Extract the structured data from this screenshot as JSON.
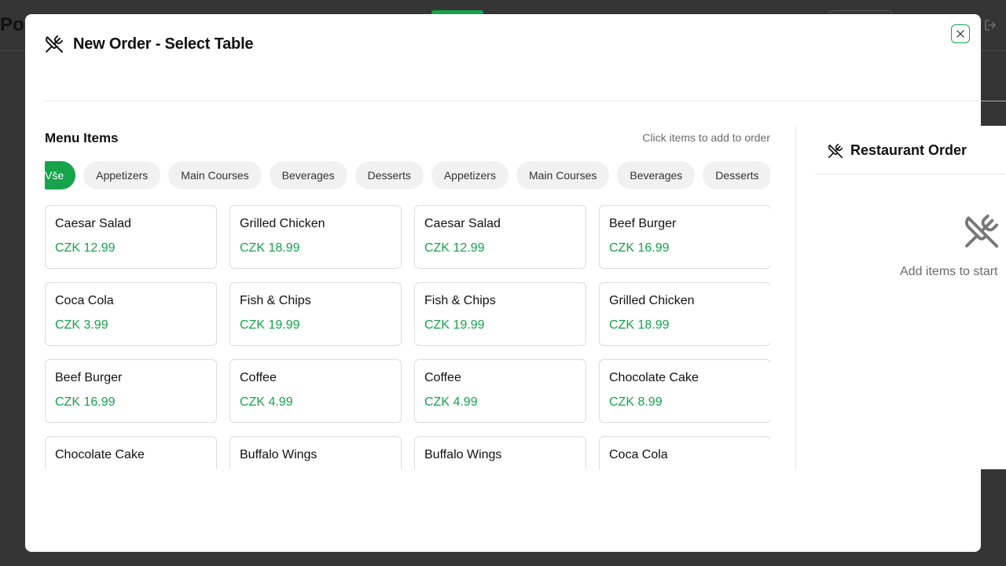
{
  "background": {
    "title": "Po"
  },
  "modal": {
    "title": "New Order - Select Table",
    "close_label": "close"
  },
  "menu": {
    "heading": "Menu Items",
    "hint": "Click items to add to order",
    "categories": [
      {
        "label": "Vše",
        "active": true
      },
      {
        "label": "Appetizers",
        "active": false
      },
      {
        "label": "Main Courses",
        "active": false
      },
      {
        "label": "Beverages",
        "active": false
      },
      {
        "label": "Desserts",
        "active": false
      },
      {
        "label": "Appetizers",
        "active": false
      },
      {
        "label": "Main Courses",
        "active": false
      },
      {
        "label": "Beverages",
        "active": false
      },
      {
        "label": "Desserts",
        "active": false
      }
    ],
    "items": [
      {
        "name": "Caesar Salad",
        "price": "CZK 12.99"
      },
      {
        "name": "Grilled Chicken",
        "price": "CZK 18.99"
      },
      {
        "name": "Caesar Salad",
        "price": "CZK 12.99"
      },
      {
        "name": "Beef Burger",
        "price": "CZK 16.99"
      },
      {
        "name": "Coca Cola",
        "price": "CZK 3.99"
      },
      {
        "name": "Fish & Chips",
        "price": "CZK 19.99"
      },
      {
        "name": "Fish & Chips",
        "price": "CZK 19.99"
      },
      {
        "name": "Grilled Chicken",
        "price": "CZK 18.99"
      },
      {
        "name": "Beef Burger",
        "price": "CZK 16.99"
      },
      {
        "name": "Coffee",
        "price": "CZK 4.99"
      },
      {
        "name": "Coffee",
        "price": "CZK 4.99"
      },
      {
        "name": "Chocolate Cake",
        "price": "CZK 8.99"
      },
      {
        "name": "Chocolate Cake",
        "price": ""
      },
      {
        "name": "Buffalo Wings",
        "price": ""
      },
      {
        "name": "Buffalo Wings",
        "price": ""
      },
      {
        "name": "Coca Cola",
        "price": ""
      }
    ]
  },
  "order": {
    "title": "Restaurant Order",
    "empty_text": "Add items to start"
  },
  "colors": {
    "accent": "#16a34a",
    "overlay": "#353535"
  },
  "icons": {
    "header": "utensils-crossed-icon",
    "close": "close-icon",
    "logout": "logout-icon"
  }
}
